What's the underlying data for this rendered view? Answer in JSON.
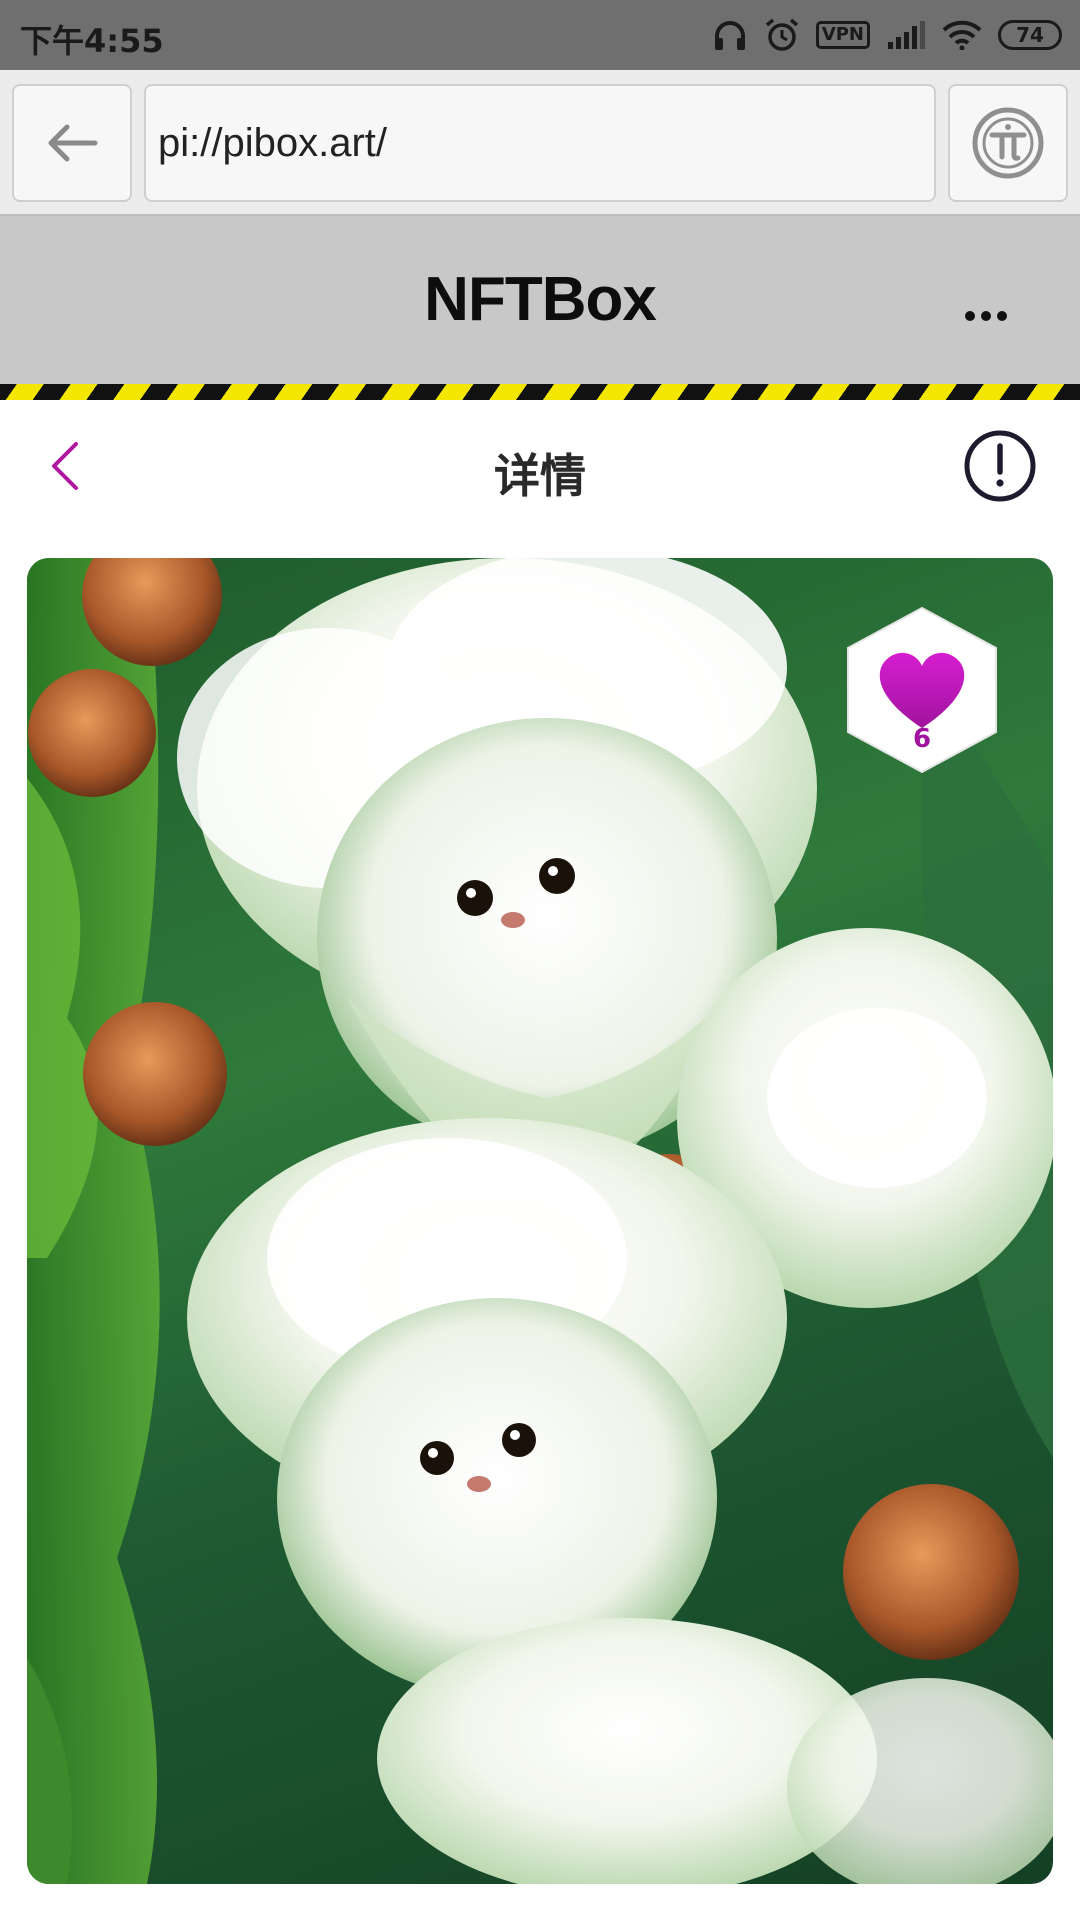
{
  "status_bar": {
    "time": "下午4:55",
    "vpn": "VPN",
    "battery": "74"
  },
  "browser": {
    "url": "pi://pibox.art/",
    "back_icon": "arrow-left-icon",
    "menu_icon": "pi-logo-icon"
  },
  "app_header": {
    "title": "NFTBox",
    "more_icon": "more-horizontal-icon"
  },
  "page_header": {
    "title": "详情",
    "back_icon": "chevron-left-icon",
    "info_icon": "info-circle-icon"
  },
  "artwork": {
    "likes": "6",
    "like_icon": "heart-icon"
  },
  "colors": {
    "accent": "#b0179f",
    "heart_top": "#d61ed0",
    "heart_bottom": "#a0139e",
    "header_bg": "#c8c8c8",
    "hazard_yellow": "#f3e600"
  }
}
